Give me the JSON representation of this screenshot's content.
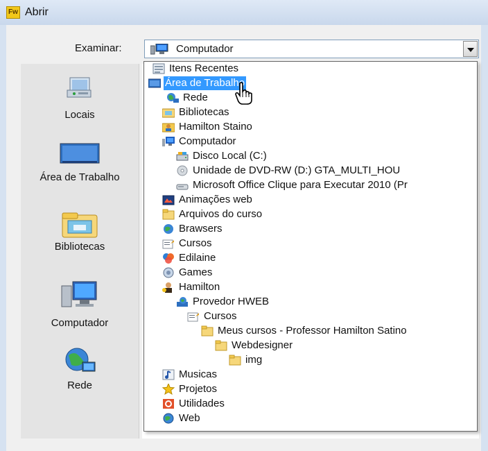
{
  "window": {
    "title": "Abrir",
    "logo_text": "Fw"
  },
  "look_in": {
    "label": "Examinar:",
    "value": "Computador"
  },
  "places": [
    {
      "label": "Locais",
      "icon": "recent-places-icon"
    },
    {
      "label": "Área de Trabalho",
      "icon": "desktop-icon"
    },
    {
      "label": "Bibliotecas",
      "icon": "libraries-icon"
    },
    {
      "label": "Computador",
      "icon": "computer-icon"
    },
    {
      "label": "Rede",
      "icon": "network-icon"
    }
  ],
  "dropdown": {
    "items": [
      {
        "label": "Itens Recentes",
        "icon": "recent-items-icon"
      },
      {
        "label": "Área de Trabalho",
        "icon": "desktop-icon",
        "selected": true
      },
      {
        "label": "Rede",
        "icon": "network-icon"
      },
      {
        "label": "Bibliotecas",
        "icon": "libraries-icon"
      },
      {
        "label": "Hamilton Staino",
        "icon": "user-folder-icon"
      },
      {
        "label": "Computador",
        "icon": "computer-icon"
      },
      {
        "label": "Disco Local (C:)",
        "icon": "hard-drive-icon"
      },
      {
        "label": "Unidade de DVD-RW (D:) GTA_MULTI_HOU",
        "icon": "dvd-drive-icon"
      },
      {
        "label": "Microsoft Office Clique para Executar 2010 (Pr",
        "icon": "virtual-drive-icon"
      },
      {
        "label": "Animações web",
        "icon": "animation-folder-icon"
      },
      {
        "label": "Arquivos do curso",
        "icon": "folder-icon"
      },
      {
        "label": "Brawsers",
        "icon": "browser-icon"
      },
      {
        "label": "Cursos",
        "icon": "document-folder-icon"
      },
      {
        "label": "Edilaine",
        "icon": "flower-icon"
      },
      {
        "label": "Games",
        "icon": "games-icon"
      },
      {
        "label": "Hamilton",
        "icon": "avatar-icon"
      },
      {
        "label": "Provedor HWEB",
        "icon": "web-globe-icon"
      },
      {
        "label": "Cursos",
        "icon": "document-folder-icon"
      },
      {
        "label": "Meus cursos - Professor Hamilton Satino",
        "icon": "folder-icon"
      },
      {
        "label": "Webdesigner",
        "icon": "folder-icon"
      },
      {
        "label": "img",
        "icon": "folder-icon"
      },
      {
        "label": "Musicas",
        "icon": "music-icon"
      },
      {
        "label": "Projetos",
        "icon": "star-icon"
      },
      {
        "label": "Utilidades",
        "icon": "office-icon"
      },
      {
        "label": "Web",
        "icon": "globe-icon"
      }
    ]
  }
}
